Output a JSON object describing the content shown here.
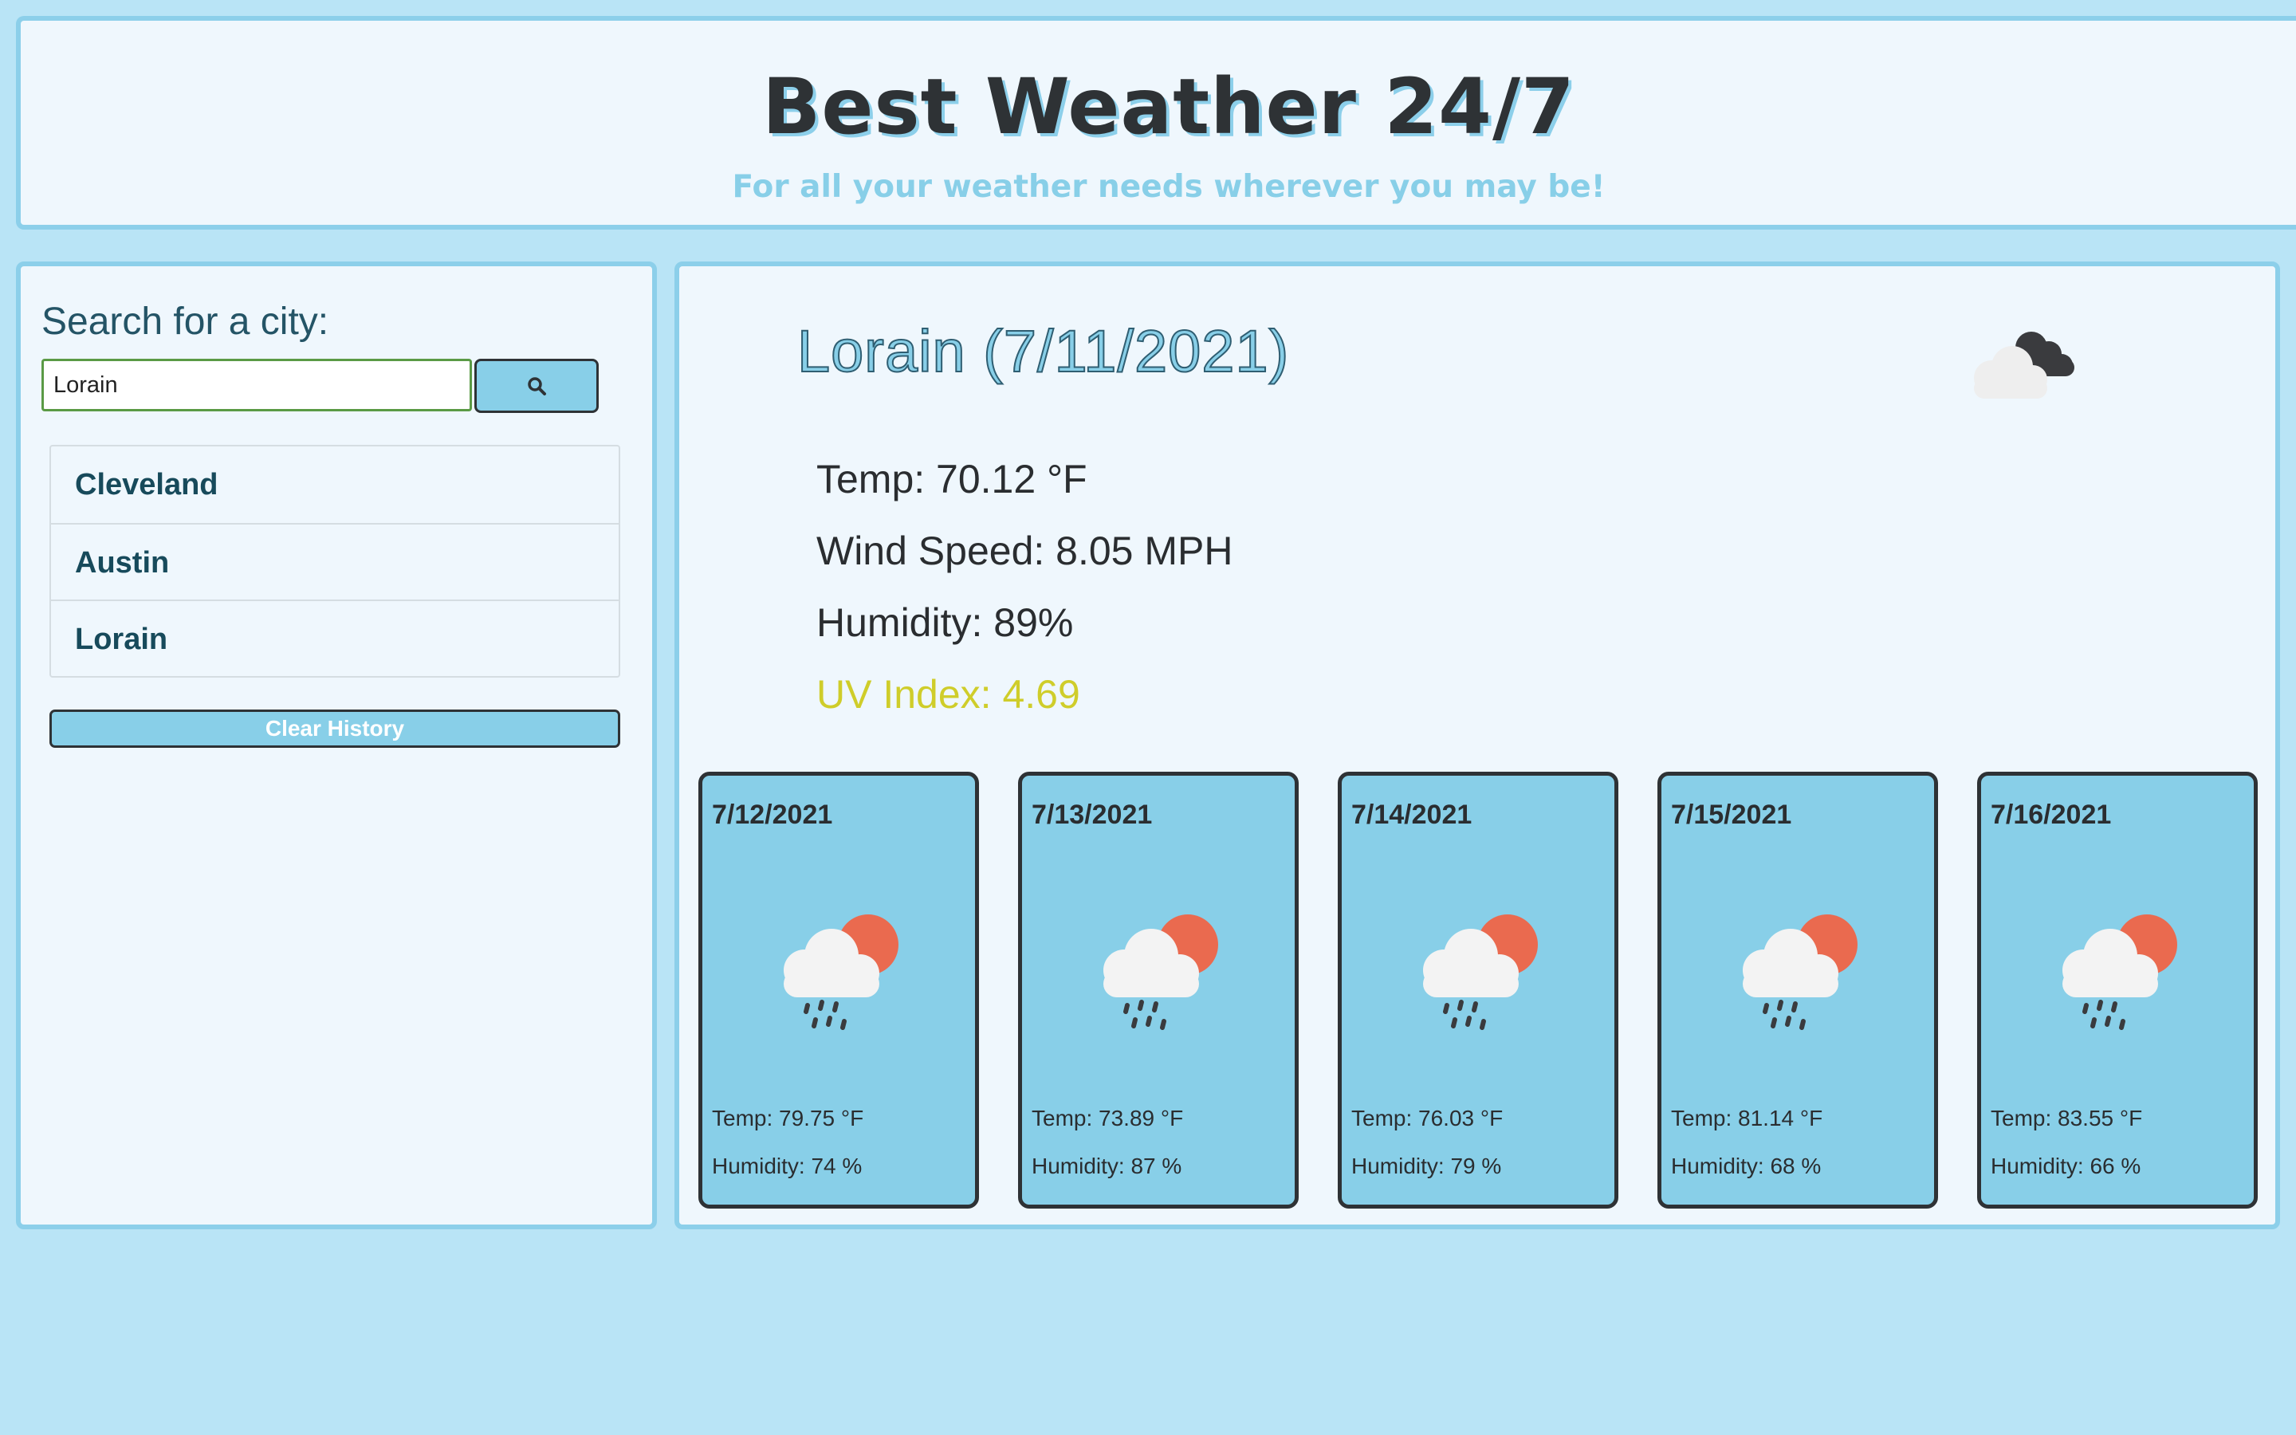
{
  "header": {
    "title": "Best Weather 24/7",
    "subtitle": "For all your weather needs wherever you may be!"
  },
  "search": {
    "label": "Search for a city:",
    "value": "Lorain",
    "button_icon": "search-icon"
  },
  "history": {
    "items": [
      "Cleveland",
      "Austin",
      "Lorain"
    ],
    "clear_label": "Clear History"
  },
  "current": {
    "title": "Lorain (7/11/2021)",
    "icon": "cloudy-icon",
    "temp": "Temp: 70.12 °F",
    "wind": "Wind Speed: 8.05 MPH",
    "humidity": "Humidity: 89%",
    "uv": "UV Index: 4.69",
    "uv_color": "#cfcd2a"
  },
  "forecast": [
    {
      "date": "7/12/2021",
      "icon": "rain-sun-icon",
      "temp": "Temp: 79.75 °F",
      "humidity": "Humidity: 74 %"
    },
    {
      "date": "7/13/2021",
      "icon": "rain-sun-icon",
      "temp": "Temp: 73.89 °F",
      "humidity": "Humidity: 87 %"
    },
    {
      "date": "7/14/2021",
      "icon": "rain-sun-icon",
      "temp": "Temp: 76.03 °F",
      "humidity": "Humidity: 79 %"
    },
    {
      "date": "7/15/2021",
      "icon": "rain-sun-icon",
      "temp": "Temp: 81.14 °F",
      "humidity": "Humidity: 68 %"
    },
    {
      "date": "7/16/2021",
      "icon": "rain-sun-icon",
      "temp": "Temp: 83.55 °F",
      "humidity": "Humidity: 66 %"
    }
  ],
  "colors": {
    "page_bg": "#b9e4f6",
    "panel_bg": "#eff7fd",
    "accent": "#88cfe8",
    "sun": "#ea6a4f"
  }
}
